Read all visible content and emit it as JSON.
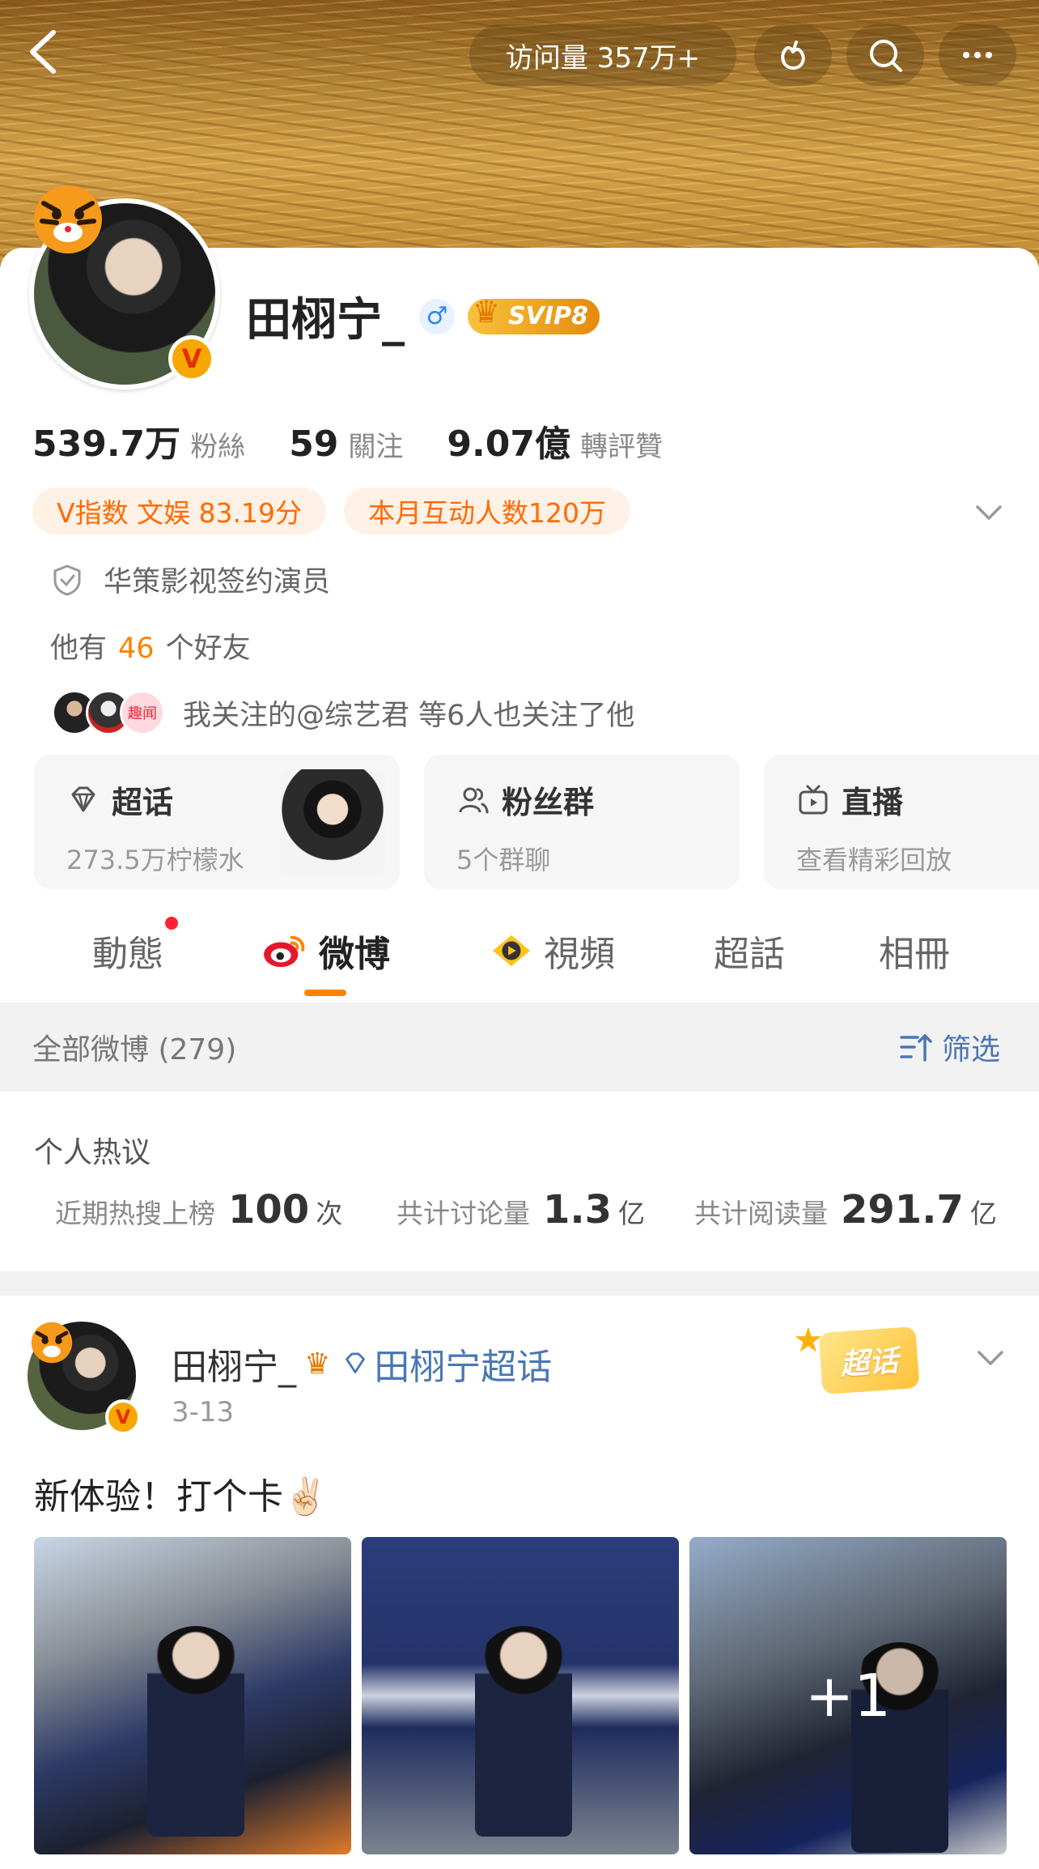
{
  "header": {
    "visits": "访问量 357万+",
    "icons": [
      "back-arrow-icon",
      "fruit-icon",
      "search-icon",
      "more-icon"
    ]
  },
  "profile": {
    "name": "田栩宁_",
    "gender_symbol": "♂",
    "svip_label": "SVIP8",
    "verified_badge": "V",
    "stats": [
      {
        "num": "539.7万",
        "label": "粉絲"
      },
      {
        "num": "59",
        "label": "關注"
      },
      {
        "num": "9.07億",
        "label": "轉評贊"
      }
    ],
    "pills": [
      "V指数 文娱 83.19分",
      "本月互动人数120万"
    ],
    "organization": "华策影视签约演员",
    "friends_prefix": "他有",
    "friends_count": "46",
    "friends_suffix": "个好友",
    "mutual": "我关注的@综艺君 等6人也关注了他",
    "mini_avatar_tag": "趣闻"
  },
  "tiles": [
    {
      "title": "超话",
      "subtitle": "273.5万柠檬水",
      "icon": "diamond-icon"
    },
    {
      "title": "粉丝群",
      "subtitle": "5个群聊",
      "icon": "people-icon"
    },
    {
      "title": "直播",
      "subtitle": "查看精彩回放",
      "icon": "tv-icon"
    }
  ],
  "tabs": [
    {
      "label": "動態",
      "has_dot": true
    },
    {
      "label": "微博",
      "active": true,
      "icon": "weibo-logo-icon"
    },
    {
      "label": "視頻",
      "icon": "video-play-icon"
    },
    {
      "label": "超話"
    },
    {
      "label": "相冊"
    }
  ],
  "filter": {
    "title": "全部微博 (279)",
    "button": "筛选"
  },
  "hot": {
    "title": "个人热议",
    "stats": [
      {
        "label": "近期热搜上榜",
        "value": "100",
        "unit": "次"
      },
      {
        "label": "共计讨论量",
        "value": "1.3",
        "unit": "亿"
      },
      {
        "label": "共计阅读量",
        "value": "291.7",
        "unit": "亿"
      }
    ]
  },
  "post": {
    "author": "田栩宁_",
    "topic": "田栩宁超话",
    "date": "3-13",
    "tag": "超话",
    "text": "新体验！打个卡✌🏻",
    "more_count": "+1",
    "photo_count": 3
  },
  "colors": {
    "accent": "#ff8200",
    "link": "#4a77b4",
    "pill_bg": "#fff1e6",
    "pill_text": "#ff6a00"
  }
}
